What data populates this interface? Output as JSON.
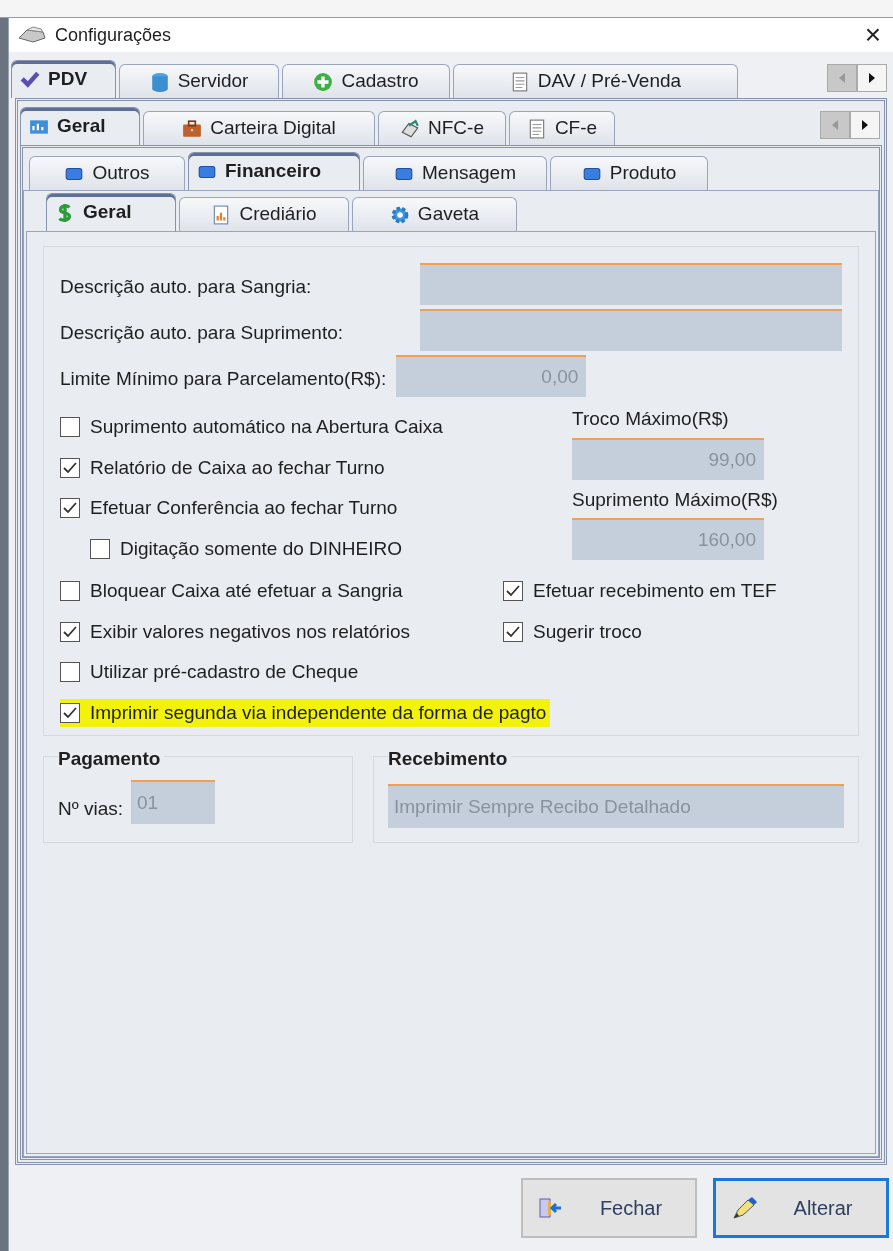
{
  "window": {
    "title": "Configurações",
    "close": "×"
  },
  "tab_rows": [
    {
      "tabs": [
        {
          "label": "PDV",
          "selected": true
        },
        {
          "label": "Servidor",
          "selected": false
        },
        {
          "label": "Cadastro",
          "selected": false
        },
        {
          "label": "DAV / Pré-Venda",
          "selected": false
        }
      ],
      "scroll": true
    },
    {
      "tabs": [
        {
          "label": "Geral",
          "selected": true
        },
        {
          "label": "Carteira Digital",
          "selected": false
        },
        {
          "label": "NFC-e",
          "selected": false
        },
        {
          "label": "CF-e",
          "selected": false
        }
      ],
      "scroll": true
    },
    {
      "tabs": [
        {
          "label": "Outros",
          "selected": false
        },
        {
          "label": "Financeiro",
          "selected": true
        },
        {
          "label": "Mensagem",
          "selected": false
        },
        {
          "label": "Produto",
          "selected": false
        }
      ],
      "scroll": false
    },
    {
      "tabs": [
        {
          "label": "Geral",
          "selected": true
        },
        {
          "label": "Crediário",
          "selected": false
        },
        {
          "label": "Gaveta",
          "selected": false
        }
      ],
      "scroll": false
    }
  ],
  "fields": [
    {
      "label": "Descrição auto. para Sangria:"
    },
    {
      "label": "Descrição auto. para Suprimento:"
    },
    {
      "label": "Limite Mínimo para Parcelamento(R$):",
      "value": "0,00"
    }
  ],
  "options": [
    {
      "label": "Suprimento automático na Abertura Caixa",
      "checked": false
    },
    {
      "label": "Relatório de Caixa ao fechar Turno",
      "checked": true
    },
    {
      "label": "Efetuar Conferência ao fechar Turno",
      "checked": true,
      "children": [
        {
          "label": "Digitação somente do DINHEIRO",
          "checked": false
        }
      ]
    }
  ],
  "limits": [
    {
      "label": "Troco Máximo(R$)",
      "value": "99,00"
    },
    {
      "label": "Suprimento Máximo(R$)",
      "value": "160,00"
    }
  ],
  "option_rows": [
    [
      {
        "label": "Bloquear Caixa até efetuar a Sangria",
        "checked": false,
        "highlighted": false
      },
      {
        "label": "Efetuar recebimento em TEF",
        "checked": true,
        "highlighted": false
      }
    ],
    [
      {
        "label": "Exibir valores negativos nos relatórios",
        "checked": true,
        "highlighted": false
      },
      {
        "label": "Sugerir troco",
        "checked": true,
        "highlighted": false
      }
    ],
    [
      {
        "label": "Utilizar pré-cadastro de Cheque",
        "checked": false,
        "highlighted": false
      }
    ],
    [
      {
        "label": "Imprimir segunda via independente da forma de pagto",
        "checked": true,
        "highlighted": true
      }
    ]
  ],
  "pagamento": {
    "title": "Pagamento",
    "label": "Nº vias:",
    "value": "01"
  },
  "recebimento": {
    "title": "Recebimento",
    "value": "Imprimir Sempre Recibo Detalhado"
  },
  "buttons": [
    {
      "label": "Fechar",
      "kind": "close",
      "focused": false
    },
    {
      "label": "Alterar",
      "kind": "edit",
      "focused": true
    }
  ]
}
